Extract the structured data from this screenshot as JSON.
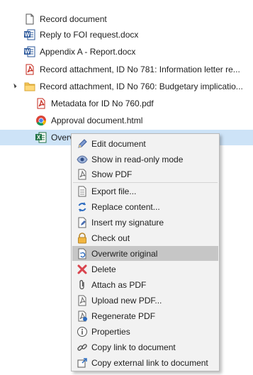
{
  "tree": {
    "items": [
      {
        "label": "Record document",
        "icon": "document-icon"
      },
      {
        "label": "Reply to FOI request.docx",
        "icon": "word-icon"
      },
      {
        "label": "Appendix A - Report.docx",
        "icon": "word-icon"
      },
      {
        "label": "Record attachment, ID No 781: Information letter re...",
        "icon": "pdf-icon"
      },
      {
        "label": "Record attachment, ID No 760: Budgetary implicatio...",
        "icon": "folder-icon"
      },
      {
        "label": "Metadata for ID No 760.pdf",
        "icon": "pdf-icon"
      },
      {
        "label": "Approval document.html",
        "icon": "chrome-icon"
      },
      {
        "label": "Overv",
        "icon": "excel-icon"
      }
    ]
  },
  "context_menu": {
    "items": [
      {
        "label": "Edit document",
        "icon": "pencil-icon"
      },
      {
        "label": "Show in read-only mode",
        "icon": "eye-icon"
      },
      {
        "label": "Show PDF",
        "icon": "pdf-page-icon"
      },
      {
        "label": "Export file...",
        "icon": "export-icon"
      },
      {
        "label": "Replace content...",
        "icon": "replace-icon"
      },
      {
        "label": "Insert my signature",
        "icon": "signature-icon"
      },
      {
        "label": "Check out",
        "icon": "lock-icon"
      },
      {
        "label": "Overwrite original",
        "icon": "overwrite-icon"
      },
      {
        "label": "Delete",
        "icon": "delete-icon"
      },
      {
        "label": "Attach as PDF",
        "icon": "paperclip-icon"
      },
      {
        "label": "Upload new PDF...",
        "icon": "upload-pdf-icon"
      },
      {
        "label": "Regenerate PDF",
        "icon": "regenerate-pdf-icon"
      },
      {
        "label": "Properties",
        "icon": "info-icon"
      },
      {
        "label": "Copy link to document",
        "icon": "link-icon"
      },
      {
        "label": "Copy external link to document",
        "icon": "external-link-icon"
      }
    ]
  }
}
